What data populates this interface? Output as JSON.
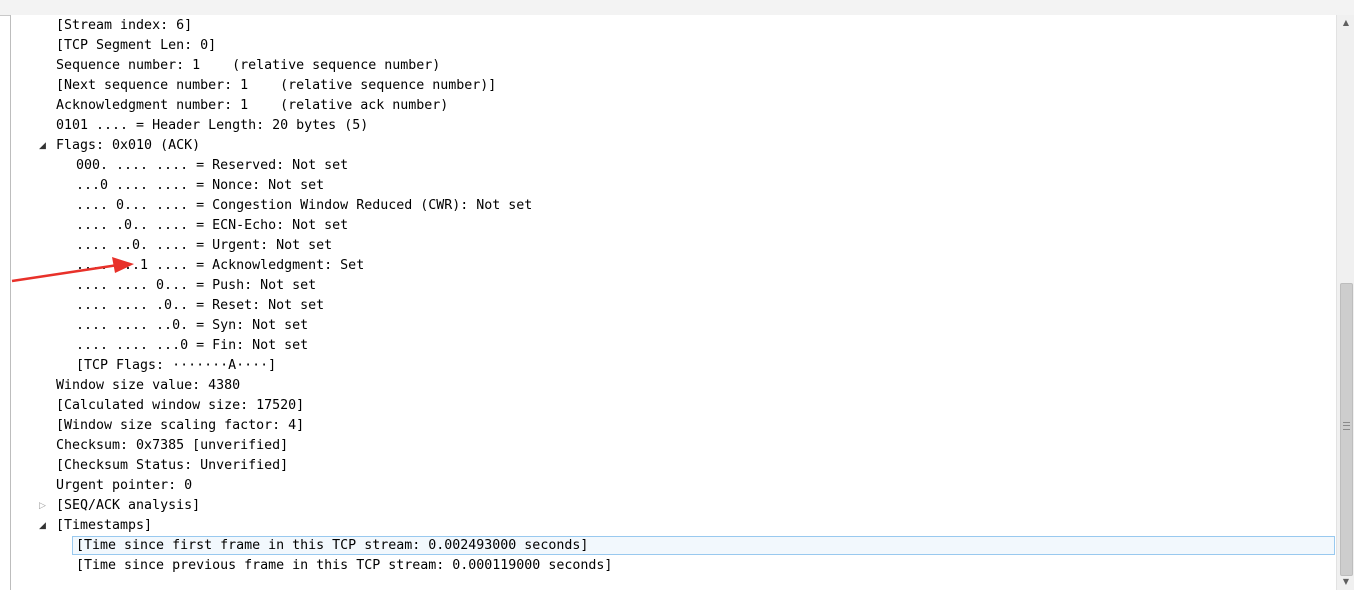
{
  "tree": {
    "rows": [
      {
        "text": "[Stream index: 6]",
        "indent": 0,
        "toggle": ""
      },
      {
        "text": "[TCP Segment Len: 0]",
        "indent": 0,
        "toggle": ""
      },
      {
        "text": "Sequence number: 1    (relative sequence number)",
        "indent": 0,
        "toggle": ""
      },
      {
        "text": "[Next sequence number: 1    (relative sequence number)]",
        "indent": 0,
        "toggle": ""
      },
      {
        "text": "Acknowledgment number: 1    (relative ack number)",
        "indent": 0,
        "toggle": ""
      },
      {
        "text": "0101 .... = Header Length: 20 bytes (5)",
        "indent": 0,
        "toggle": ""
      },
      {
        "text": "Flags: 0x010 (ACK)",
        "indent": 0,
        "toggle": "open"
      },
      {
        "text": "000. .... .... = Reserved: Not set",
        "indent": 1,
        "toggle": ""
      },
      {
        "text": "...0 .... .... = Nonce: Not set",
        "indent": 1,
        "toggle": ""
      },
      {
        "text": ".... 0... .... = Congestion Window Reduced (CWR): Not set",
        "indent": 1,
        "toggle": ""
      },
      {
        "text": ".... .0.. .... = ECN-Echo: Not set",
        "indent": 1,
        "toggle": ""
      },
      {
        "text": ".... ..0. .... = Urgent: Not set",
        "indent": 1,
        "toggle": ""
      },
      {
        "text": ".... ...1 .... = Acknowledgment: Set",
        "indent": 1,
        "toggle": ""
      },
      {
        "text": ".... .... 0... = Push: Not set",
        "indent": 1,
        "toggle": ""
      },
      {
        "text": ".... .... .0.. = Reset: Not set",
        "indent": 1,
        "toggle": ""
      },
      {
        "text": ".... .... ..0. = Syn: Not set",
        "indent": 1,
        "toggle": ""
      },
      {
        "text": ".... .... ...0 = Fin: Not set",
        "indent": 1,
        "toggle": ""
      },
      {
        "text": "[TCP Flags: ·······A····]",
        "indent": 1,
        "toggle": ""
      },
      {
        "text": "Window size value: 4380",
        "indent": 0,
        "toggle": ""
      },
      {
        "text": "[Calculated window size: 17520]",
        "indent": 0,
        "toggle": ""
      },
      {
        "text": "[Window size scaling factor: 4]",
        "indent": 0,
        "toggle": ""
      },
      {
        "text": "Checksum: 0x7385 [unverified]",
        "indent": 0,
        "toggle": ""
      },
      {
        "text": "[Checksum Status: Unverified]",
        "indent": 0,
        "toggle": ""
      },
      {
        "text": "Urgent pointer: 0",
        "indent": 0,
        "toggle": ""
      },
      {
        "text": "[SEQ/ACK analysis]",
        "indent": 0,
        "toggle": "closed"
      },
      {
        "text": "[Timestamps]",
        "indent": 0,
        "toggle": "open"
      },
      {
        "text": "[Time since first frame in this TCP stream: 0.002493000 seconds]",
        "indent": 1,
        "toggle": "",
        "selected": true
      },
      {
        "text": "[Time since previous frame in this TCP stream: 0.000119000 seconds]",
        "indent": 1,
        "toggle": ""
      }
    ]
  },
  "scrollbar": {
    "up_icon": "scroll-up-arrow-icon",
    "down_icon": "scroll-down-arrow-icon"
  },
  "annotation": {
    "arrow_color": "#e8312a"
  },
  "colors": {
    "selection_border": "#99c9ef",
    "selection_fill": "#f2f8fd"
  }
}
